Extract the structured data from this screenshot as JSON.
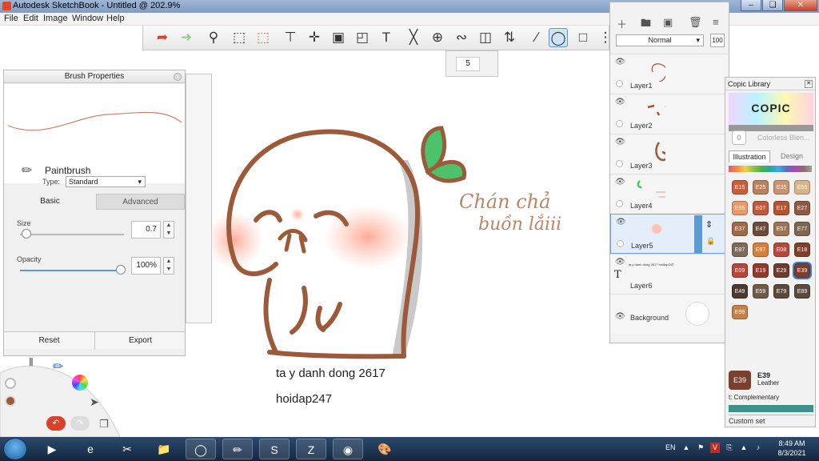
{
  "window": {
    "title": "Autodesk SketchBook - Untitled @ 202.9%"
  },
  "menu": [
    "File",
    "Edit",
    "Image",
    "Window",
    "Help"
  ],
  "toolbar": {
    "brush_size_value": "5"
  },
  "brush_panel": {
    "title": "Brush Properties",
    "brush_name": "Paintbrush",
    "type_label": "Type:",
    "type_value": "Standard",
    "tab_basic": "Basic",
    "tab_advanced": "Advanced",
    "size_label": "Size",
    "size_value": "0.7",
    "size_fraction": 0.05,
    "opacity_label": "Opacity",
    "opacity_value": "100%",
    "opacity_fraction": 1.0,
    "reset_label": "Reset",
    "export_label": "Export"
  },
  "layers_panel": {
    "blend_mode": "Normal",
    "opacity_short": "100",
    "layers": [
      "Layer1",
      "Layer2",
      "Layer3",
      "Layer4",
      "Layer5",
      "Layer6",
      "Background"
    ],
    "selected_layer": "Layer5",
    "layer6_preview_text": "ta y danh dong 2617 hoidap247"
  },
  "copic_panel": {
    "title": "Copic Library",
    "logo": "COPIC",
    "blend_count": "0",
    "blend_label": "Colorless Blen...",
    "tab_illustration": "Illustration",
    "tab_design": "Design",
    "swatches": [
      {
        "code": "E15",
        "color": "#c75f3b"
      },
      {
        "code": "E25",
        "color": "#b9825e"
      },
      {
        "code": "E35",
        "color": "#c9936f"
      },
      {
        "code": "E55",
        "color": "#d8b48a"
      },
      {
        "code": "E95",
        "color": "#e89a6a"
      },
      {
        "code": "E07",
        "color": "#c05a3c"
      },
      {
        "code": "E17",
        "color": "#b5552f"
      },
      {
        "code": "E27",
        "color": "#8d5b44"
      },
      {
        "code": "E37",
        "color": "#9d6b45"
      },
      {
        "code": "E47",
        "color": "#6b4d3a"
      },
      {
        "code": "E57",
        "color": "#9a7456"
      },
      {
        "code": "E77",
        "color": "#7d6650"
      },
      {
        "code": "E87",
        "color": "#7d6b5a"
      },
      {
        "code": "E97",
        "color": "#d77f3e"
      },
      {
        "code": "E08",
        "color": "#b8493a"
      },
      {
        "code": "E18",
        "color": "#7f3f2c"
      },
      {
        "code": "E09",
        "color": "#b5473a"
      },
      {
        "code": "E19",
        "color": "#8e3b2c"
      },
      {
        "code": "E29",
        "color": "#6e3b2e"
      },
      {
        "code": "E39",
        "color": "#7b3f2e"
      },
      {
        "code": "E49",
        "color": "#4a3a30"
      },
      {
        "code": "E59",
        "color": "#6f5a48"
      },
      {
        "code": "E79",
        "color": "#5b4a3a"
      },
      {
        "code": "E89",
        "color": "#5c4a3e"
      },
      {
        "code": "E99",
        "color": "#c4824a"
      }
    ],
    "selected_code": "E39",
    "selected_name": "Leather",
    "complementary_label": "t: Complementary",
    "custom_set_label": "Custom set"
  },
  "artwork": {
    "handwriting_line1": "Chán chả",
    "handwriting_line2": "buồn lắiii",
    "text_line1": "ta y danh dong 2617",
    "text_line2": "hoidap247",
    "stroke_color": "#9c5a3a",
    "leaf_color": "#4cc36b"
  },
  "tray": {
    "lang": "EN",
    "time": "8:49 AM",
    "date": "8/3/2021"
  },
  "taskbar_apps": [
    "media-player-icon",
    "internet-explorer-icon",
    "snipping-tool-icon",
    "file-explorer-icon",
    "chrome-icon",
    "sketchbook-icon",
    "skype-icon",
    "zalo-icon",
    "zoom-icon",
    "paint-icon"
  ]
}
